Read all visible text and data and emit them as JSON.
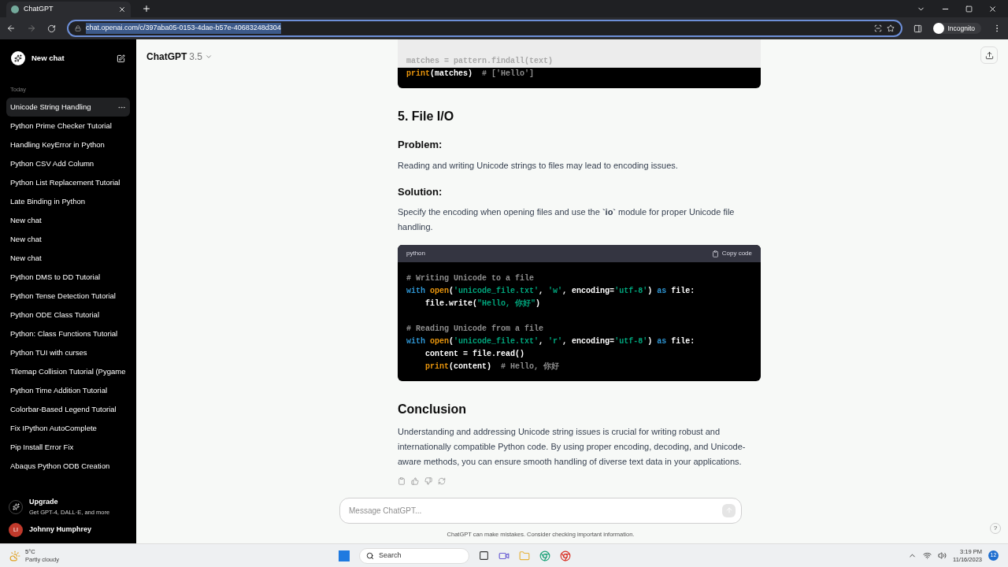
{
  "browser": {
    "tab_title": "ChatGPT",
    "url": "chat.openai.com/c/397aba05-0153-4dae-b57e-40683248d304",
    "profile": "Incognito"
  },
  "sidebar": {
    "new_chat": "New chat",
    "section": "Today",
    "items": [
      {
        "label": "Unicode String Handling",
        "selected": true
      },
      {
        "label": "Python Prime Checker Tutorial",
        "selected": false
      },
      {
        "label": "Handling KeyError in Python",
        "selected": false
      },
      {
        "label": "Python CSV Add Column",
        "selected": false
      },
      {
        "label": "Python List Replacement Tutorial",
        "selected": false
      },
      {
        "label": "Late Binding in Python",
        "selected": false
      },
      {
        "label": "New chat",
        "selected": false
      },
      {
        "label": "New chat",
        "selected": false
      },
      {
        "label": "New chat",
        "selected": false
      },
      {
        "label": "Python DMS to DD Tutorial",
        "selected": false
      },
      {
        "label": "Python Tense Detection Tutorial",
        "selected": false
      },
      {
        "label": "Python ODE Class Tutorial",
        "selected": false
      },
      {
        "label": "Python: Class Functions Tutorial",
        "selected": false
      },
      {
        "label": "Python TUI with curses",
        "selected": false
      },
      {
        "label": "Tilemap Collision Tutorial (Pygame",
        "selected": false
      },
      {
        "label": "Python Time Addition Tutorial",
        "selected": false
      },
      {
        "label": "Colorbar-Based Legend Tutorial",
        "selected": false
      },
      {
        "label": "Fix IPython AutoComplete",
        "selected": false
      },
      {
        "label": "Pip Install Error Fix",
        "selected": false
      },
      {
        "label": "Abaqus Python ODB Creation",
        "selected": false
      }
    ],
    "upgrade": {
      "title": "Upgrade",
      "subtitle": "Get GPT-4, DALL·E, and more"
    },
    "user": {
      "initials": "LI",
      "name": "Johnny Humphrey"
    }
  },
  "header": {
    "model": "ChatGPT",
    "version": "3.5"
  },
  "conversation": [
    {
      "kind": "code_tail",
      "lines": [
        {
          "kind": "code",
          "faded": true,
          "tokens": [
            {
              "kind": "plain",
              "text": "matches = pattern.findall(text)"
            }
          ]
        },
        {
          "kind": "code",
          "faded": false,
          "tokens": [
            {
              "kind": "func",
              "text": "print"
            },
            {
              "kind": "plain",
              "text": "(matches)  "
            },
            {
              "kind": "comment",
              "text": "# ['Hello']"
            }
          ]
        }
      ]
    },
    {
      "kind": "h2",
      "text": "5. File I/O"
    },
    {
      "kind": "h3",
      "text": "Problem:"
    },
    {
      "kind": "p",
      "text": "Reading and writing Unicode strings to files may lead to encoding issues."
    },
    {
      "kind": "h3",
      "text": "Solution:"
    },
    {
      "kind": "p",
      "text": "Specify the encoding when opening files and use the **`io`** module for proper Unicode file handling."
    },
    {
      "kind": "code",
      "language": "python",
      "copy": "Copy code",
      "lines": [
        {
          "kind": "code",
          "faded": false,
          "tokens": [
            {
              "kind": "comment",
              "text": "# Writing Unicode to a file"
            }
          ]
        },
        {
          "kind": "code",
          "faded": false,
          "tokens": [
            {
              "kind": "keyword",
              "text": "with "
            },
            {
              "kind": "func",
              "text": "open"
            },
            {
              "kind": "plain",
              "text": "("
            },
            {
              "kind": "string",
              "text": "'unicode_file.txt'"
            },
            {
              "kind": "plain",
              "text": ", "
            },
            {
              "kind": "string",
              "text": "'w'"
            },
            {
              "kind": "plain",
              "text": ", encoding="
            },
            {
              "kind": "string",
              "text": "'utf-8'"
            },
            {
              "kind": "plain",
              "text": ") "
            },
            {
              "kind": "keyword",
              "text": "as"
            },
            {
              "kind": "plain",
              "text": " file:"
            }
          ]
        },
        {
          "kind": "code",
          "faded": false,
          "tokens": [
            {
              "kind": "plain",
              "text": "    file.write("
            },
            {
              "kind": "string",
              "text": "\"Hello, 你好\""
            },
            {
              "kind": "plain",
              "text": ")"
            }
          ]
        },
        {
          "kind": "blank"
        },
        {
          "kind": "code",
          "faded": false,
          "tokens": [
            {
              "kind": "comment",
              "text": "# Reading Unicode from a file"
            }
          ]
        },
        {
          "kind": "code",
          "faded": false,
          "tokens": [
            {
              "kind": "keyword",
              "text": "with "
            },
            {
              "kind": "func",
              "text": "open"
            },
            {
              "kind": "plain",
              "text": "("
            },
            {
              "kind": "string",
              "text": "'unicode_file.txt'"
            },
            {
              "kind": "plain",
              "text": ", "
            },
            {
              "kind": "string",
              "text": "'r'"
            },
            {
              "kind": "plain",
              "text": ", encoding="
            },
            {
              "kind": "string",
              "text": "'utf-8'"
            },
            {
              "kind": "plain",
              "text": ") "
            },
            {
              "kind": "keyword",
              "text": "as"
            },
            {
              "kind": "plain",
              "text": " file:"
            }
          ]
        },
        {
          "kind": "code",
          "faded": false,
          "tokens": [
            {
              "kind": "plain",
              "text": "    content = file.read()"
            }
          ]
        },
        {
          "kind": "code",
          "faded": false,
          "tokens": [
            {
              "kind": "func",
              "text": "    print"
            },
            {
              "kind": "plain",
              "text": "(content)  "
            },
            {
              "kind": "comment",
              "text": "# Hello, 你好"
            }
          ]
        }
      ]
    },
    {
      "kind": "h2",
      "text": "Conclusion"
    },
    {
      "kind": "p",
      "text": "Understanding and addressing Unicode string issues is crucial for writing robust and internationally compatible Python code. By using proper encoding, decoding, and Unicode-aware methods, you can ensure smooth handling of diverse text data in your applications."
    },
    {
      "kind": "actions"
    }
  ],
  "composer": {
    "placeholder": "Message ChatGPT...",
    "disclaimer": "ChatGPT can make mistakes. Consider checking important information.",
    "help": "?"
  },
  "taskbar": {
    "temperature": "5°C",
    "weather": "Partly cloudy",
    "search": "Search",
    "time": "3:19 PM",
    "date": "11/16/2023",
    "notifications": "12"
  }
}
